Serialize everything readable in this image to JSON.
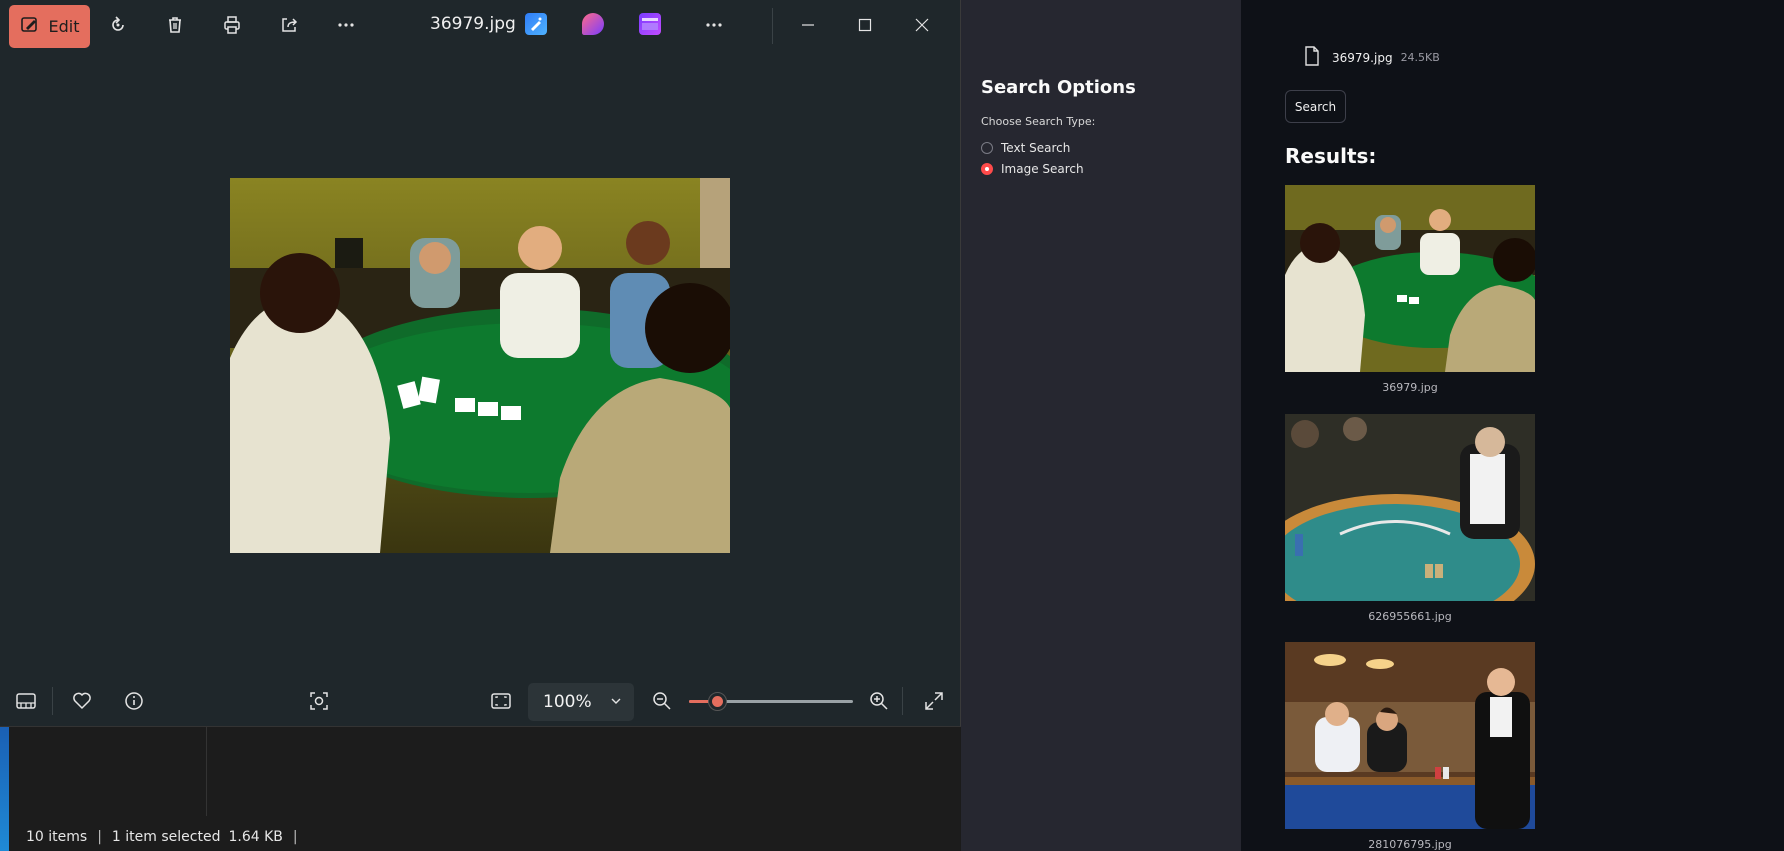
{
  "viewer": {
    "edit_label": "Edit",
    "file_title": "36979.jpg",
    "zoom_level": "100%",
    "zoom_fraction": 0.17
  },
  "explorer": {
    "status": {
      "items": "10 items",
      "selected": "1 item selected",
      "size": "1.64 KB"
    }
  },
  "sidebar": {
    "title": "Search Options",
    "choose_label": "Choose Search Type:",
    "options": [
      {
        "label": "Text Search",
        "checked": false
      },
      {
        "label": "Image Search",
        "checked": true
      }
    ]
  },
  "main": {
    "uploaded_file": {
      "name": "36979.jpg",
      "size": "24.5KB"
    },
    "search_button": "Search",
    "results_title": "Results:",
    "results": [
      {
        "caption": "36979.jpg"
      },
      {
        "caption": "626955661.jpg"
      },
      {
        "caption": "281076795.jpg"
      }
    ]
  },
  "colors": {
    "accent": "#e46e5e",
    "radio_accent": "#ff4b4b",
    "viewer_bg": "#1f272b",
    "sidebar_bg": "#262730",
    "main_bg": "#0e1117"
  }
}
